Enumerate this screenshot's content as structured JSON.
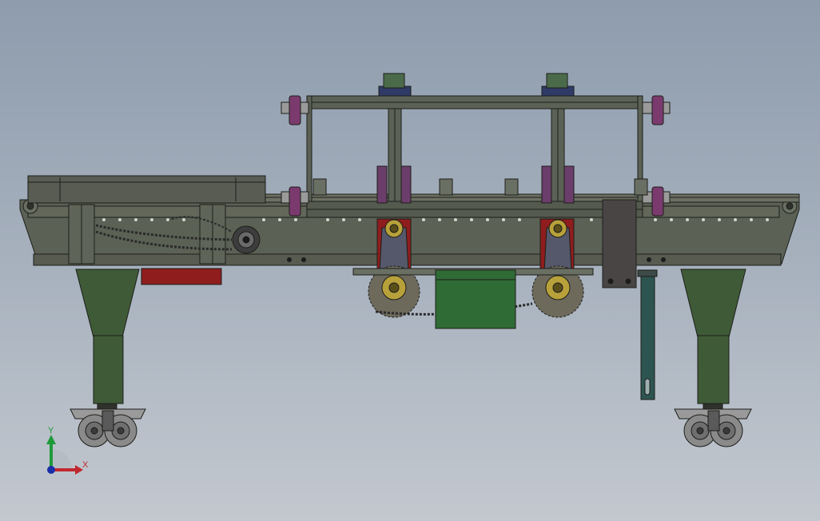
{
  "view": {
    "background_top": "#8e9cad",
    "background_bottom": "#c3c8cf"
  },
  "triad": {
    "x_label": "X",
    "y_label": "Y",
    "x_color": "#c0282e",
    "y_color": "#1f9a3a",
    "z_color": "#1a2ea8"
  },
  "colors": {
    "frame": "#5c6155",
    "frame_dark": "#2f322c",
    "legs": "#3f5a37",
    "motor": "#2f6b35",
    "red_parts": "#8f1d1d",
    "cover": "#4a4545",
    "sprocket": "#b8a13a",
    "roller": "#7b3a6e",
    "wheel": "#8a8a8a",
    "pole": "#2d5450"
  },
  "parts": [
    "side-conveyor-frame",
    "top-frame",
    "support-legs",
    "caster-wheels",
    "drive-motor",
    "chain-drive",
    "guide-rollers",
    "side-cover-plate",
    "adjustment-pole"
  ]
}
